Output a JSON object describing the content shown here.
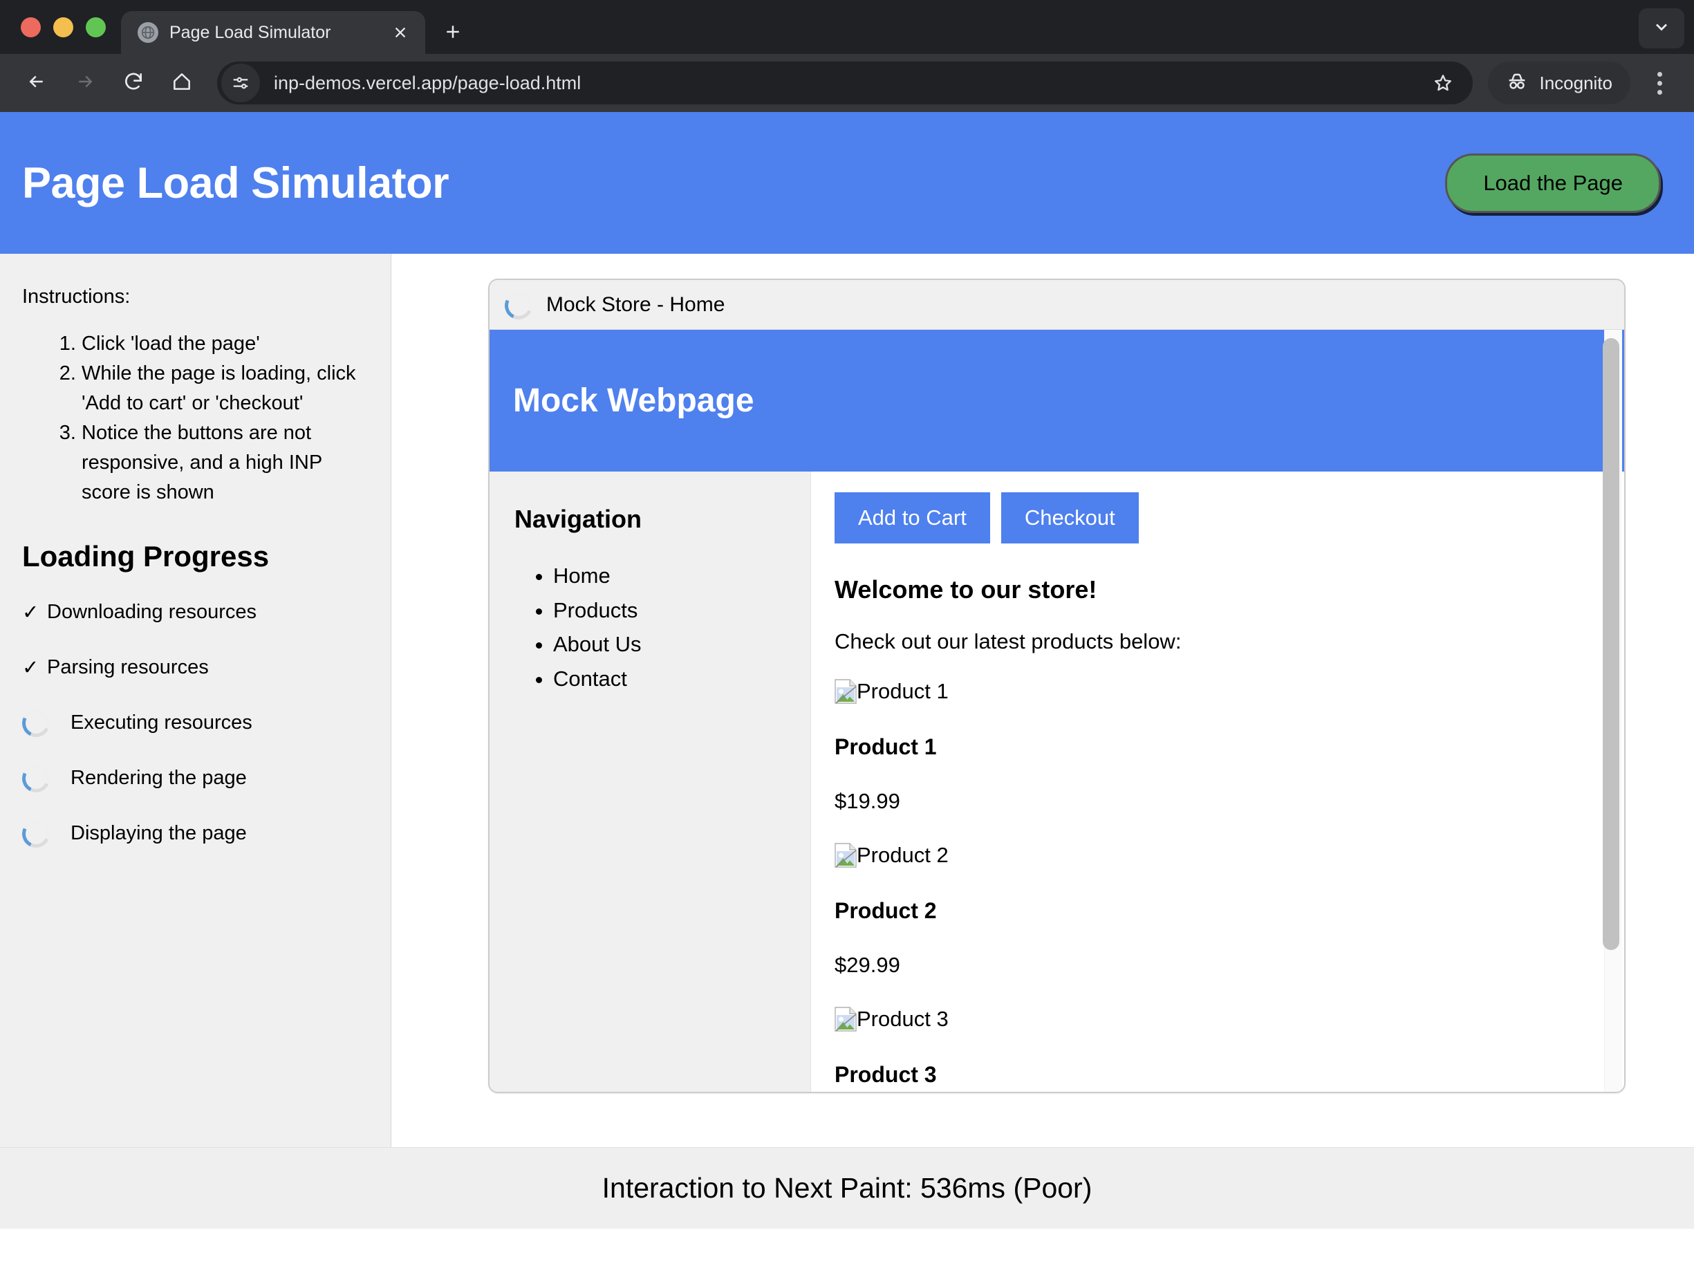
{
  "browser": {
    "tab": {
      "title": "Page Load Simulator",
      "favicon_icon": "globe-icon",
      "close_icon": "close-icon"
    },
    "new_tab_icon": "plus-icon",
    "tab_list_icon": "chevron-down-icon",
    "nav": {
      "back_icon": "arrow-left-icon",
      "forward_icon": "arrow-right-icon",
      "reload_icon": "reload-icon",
      "home_icon": "home-icon"
    },
    "omnibox": {
      "url": "inp-demos.vercel.app/page-load.html",
      "site_settings_icon": "tune-icon",
      "bookmark_icon": "star-icon"
    },
    "profile": {
      "label": "Incognito",
      "icon": "incognito-icon"
    },
    "menu_icon": "kebab-menu-icon"
  },
  "page": {
    "header": {
      "title": "Page Load Simulator",
      "load_button": "Load the Page",
      "bg_color": "#4E80EE",
      "button_color": "#54a761"
    },
    "sidebar": {
      "instructions_label": "Instructions:",
      "instructions": [
        "Click 'load the page'",
        "While the page is loading, click 'Add to cart' or 'checkout'",
        "Notice the buttons are not responsive, and a high INP score is shown"
      ],
      "progress_title": "Loading Progress",
      "progress_items": [
        {
          "label": "Downloading resources",
          "state": "done",
          "mark": "✓"
        },
        {
          "label": "Parsing resources",
          "state": "done",
          "mark": "✓"
        },
        {
          "label": "Executing resources",
          "state": "loading",
          "mark": ""
        },
        {
          "label": "Rendering the page",
          "state": "loading",
          "mark": ""
        },
        {
          "label": "Displaying the page",
          "state": "loading",
          "mark": ""
        }
      ],
      "spinner_color": "#5b9bd8"
    },
    "mock_window": {
      "titlebar": {
        "title": "Mock Store - Home",
        "spinner_icon": "loading-spinner-icon"
      },
      "hero_title": "Mock Webpage",
      "nav": {
        "heading": "Navigation",
        "links": [
          "Home",
          "Products",
          "About Us",
          "Contact"
        ]
      },
      "actions": {
        "add_to_cart": "Add to Cart",
        "checkout": "Checkout"
      },
      "welcome_heading": "Welcome to our store!",
      "intro_text": "Check out our latest products below:",
      "products": [
        {
          "image_alt": "Product 1",
          "name": "Product 1",
          "price": "$19.99"
        },
        {
          "image_alt": "Product 2",
          "name": "Product 2",
          "price": "$29.99"
        },
        {
          "image_alt": "Product 3",
          "name": "Product 3",
          "price": ""
        }
      ]
    },
    "statusbar": {
      "text": "Interaction to Next Paint: 536ms (Poor)"
    }
  }
}
